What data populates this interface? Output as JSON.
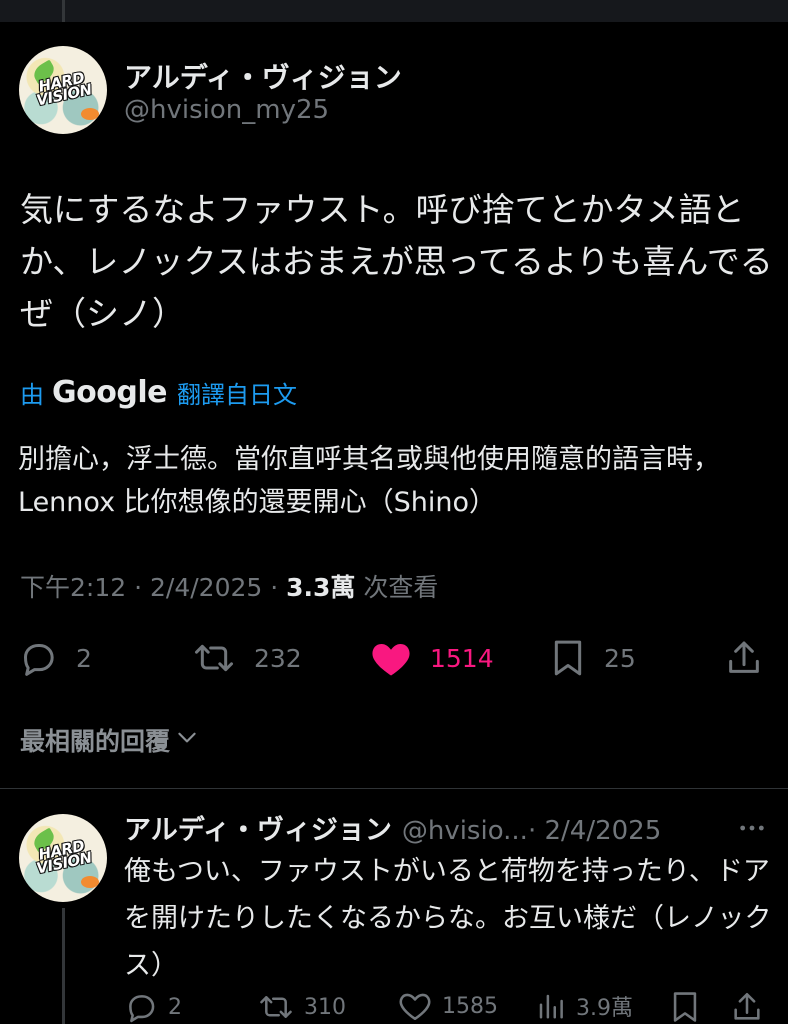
{
  "tweet": {
    "author_name": "アルディ・ヴィジョン",
    "author_handle": "@hvision_my25",
    "avatar_text": "HARD VISION",
    "text": "気にするなよファウスト。呼び捨てとかタメ語とか、レノックスはおまえが思ってるよりも喜んでるぜ（シノ）",
    "translation": {
      "by": "由",
      "provider": "Google",
      "source": "翻譯自日文",
      "text": "別擔心，浮士德。當你直呼其名或與他使用隨意的語言時，Lennox 比你想像的還要開心（Shino）"
    },
    "time": "下午2:12",
    "date": "2/4/2025",
    "views_count": "3.3萬",
    "views_label": "次查看",
    "actions": {
      "replies": "2",
      "retweets": "232",
      "likes": "1514",
      "bookmarks": "25"
    }
  },
  "replies_sort_label": "最相關的回覆",
  "reply": {
    "author_name": "アルディ・ヴィジョン",
    "author_handle": "@hvisio...",
    "date": "· 2/4/2025",
    "text": "俺もつい、ファウストがいると荷物を持ったり、ドアを開けたりしたくなるからな。お互い様だ（レノックス）",
    "actions": {
      "replies": "2",
      "retweets": "310",
      "likes": "1585",
      "views": "3.9萬"
    }
  },
  "icons": {
    "reply": "speech-bubble-icon",
    "retweet": "retweet-icon",
    "like": "heart-icon",
    "bookmark": "bookmark-icon",
    "share": "share-icon",
    "views": "bar-chart-icon",
    "more": "more-dots-icon",
    "sort": "chevron-down-icon"
  },
  "colors": {
    "background": "#000000",
    "text": "#e7e9ea",
    "muted": "#71767b",
    "link": "#1d9bf0",
    "like": "#f91880"
  }
}
